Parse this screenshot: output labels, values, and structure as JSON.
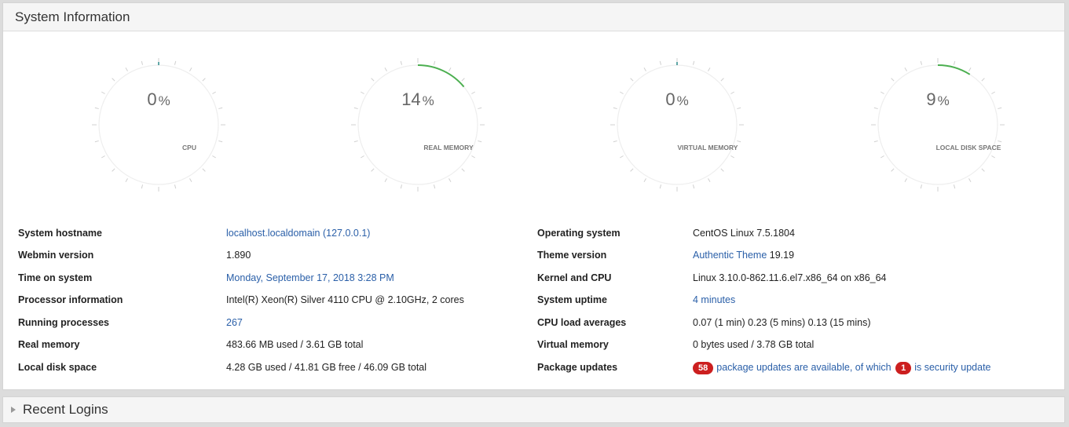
{
  "system_info": {
    "title": "System Information",
    "gauges": [
      {
        "label": "CPU",
        "value": 0
      },
      {
        "label": "REAL MEMORY",
        "value": 14
      },
      {
        "label": "VIRTUAL MEMORY",
        "value": 0
      },
      {
        "label": "LOCAL DISK SPACE",
        "value": 9
      }
    ],
    "percent_sign": "%",
    "accent_color": "#4caf50",
    "left_rows": [
      {
        "key": "System hostname",
        "value": "localhost.localdomain (127.0.0.1)",
        "link": true
      },
      {
        "key": "Webmin version",
        "value": "1.890",
        "link": false
      },
      {
        "key": "Time on system",
        "value": "Monday, September 17, 2018 3:28 PM",
        "link": true
      },
      {
        "key": "Processor information",
        "value": "Intel(R) Xeon(R) Silver 4110 CPU @ 2.10GHz, 2 cores",
        "link": false
      },
      {
        "key": "Running processes",
        "value": "267",
        "link": true
      },
      {
        "key": "Real memory",
        "value": "483.66 MB used / 3.61 GB total",
        "link": false
      },
      {
        "key": "Local disk space",
        "value": "4.28 GB used / 41.81 GB free / 46.09 GB total",
        "link": false
      }
    ],
    "right_rows": [
      {
        "key": "Operating system",
        "value": "CentOS Linux 7.5.1804"
      },
      {
        "key": "Theme version",
        "value_link": "Authentic Theme",
        "value_rest": " 19.19"
      },
      {
        "key": "Kernel and CPU",
        "value": "Linux 3.10.0-862.11.6.el7.x86_64 on x86_64"
      },
      {
        "key": "System uptime",
        "value": "4 minutes",
        "link": true
      },
      {
        "key": "CPU load averages",
        "value": "0.07 (1 min) 0.23 (5 mins) 0.13 (15 mins)"
      },
      {
        "key": "Virtual memory",
        "value": "0 bytes used / 3.78 GB total"
      },
      {
        "key": "Package updates",
        "updates_count": "58",
        "updates_text": "package updates are available, of which",
        "security_count": "1",
        "security_text": "is security update"
      }
    ]
  },
  "recent_logins": {
    "title": "Recent Logins"
  }
}
